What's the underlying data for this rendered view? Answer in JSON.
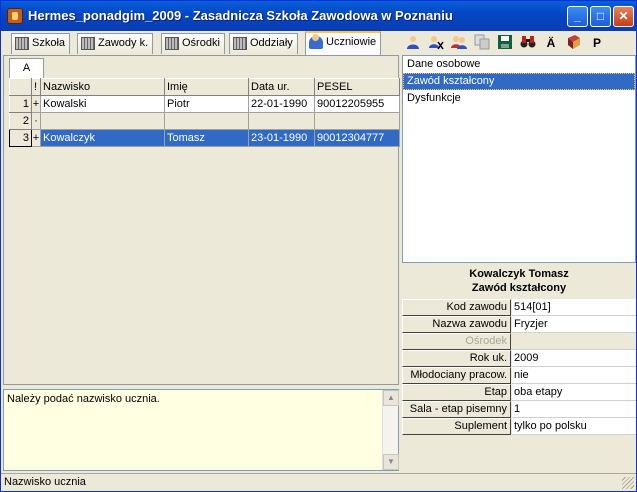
{
  "window": {
    "title": "Hermes_ponadgim_2009 - Zasadnicza Szkoła Zawodowa w Poznaniu",
    "controls": {
      "minimize": "_",
      "maximize": "□",
      "close": "✕"
    }
  },
  "tabs": [
    {
      "label": "Szkoła",
      "icon": "building-icon",
      "active": false
    },
    {
      "label": "Zawody k.",
      "icon": "building-icon",
      "active": false
    },
    {
      "label": "Ośrodki",
      "icon": "building-icon",
      "active": false
    },
    {
      "label": "Oddziały",
      "icon": "building-icon",
      "active": false
    },
    {
      "label": "Uczniowie",
      "icon": "students-icon",
      "active": true
    }
  ],
  "toolbar": {
    "icons": [
      "add-user-icon",
      "cut-user-icon",
      "move-users-icon",
      "copy-icon",
      "save-icon",
      "binoculars-icon",
      "a-umlaut-icon",
      "book-icon",
      "p-icon"
    ],
    "glyphs": {
      "a_umlaut": "Ä",
      "p": "P"
    }
  },
  "grid": {
    "filter_tab": "A",
    "columns": [
      "!",
      "Nazwisko",
      "Imię",
      "Data ur.",
      "PESEL"
    ],
    "rows": [
      {
        "num": "1",
        "flag": "+",
        "nazwisko": "Kowalski",
        "imie": "Piotr",
        "data_ur": "22-01-1990",
        "pesel": "90012205955",
        "selected": false
      },
      {
        "num": "2",
        "flag": "·",
        "nazwisko": "",
        "imie": "",
        "data_ur": "",
        "pesel": "",
        "selected": false
      },
      {
        "num": "3",
        "flag": "+",
        "nazwisko": "Kowalczyk",
        "imie": "Tomasz",
        "data_ur": "23-01-1990",
        "pesel": "90012304777",
        "selected": true
      }
    ]
  },
  "message": "Należy podać nazwisko ucznia.",
  "status": "Nazwisko ucznia",
  "sections": [
    {
      "label": "Dane osobowe",
      "selected": false
    },
    {
      "label": "Zawód kształcony",
      "selected": true
    },
    {
      "label": "Dysfunkcje",
      "selected": false
    }
  ],
  "detail": {
    "name": "Kowalczyk Tomasz",
    "section": "Zawód kształcony"
  },
  "props": [
    {
      "label": "Kod zawodu",
      "value": "514[01]",
      "disabled": false
    },
    {
      "label": "Nazwa zawodu",
      "value": "Fryzjer",
      "disabled": false
    },
    {
      "label": "Ośrodek",
      "value": "",
      "disabled": true
    },
    {
      "label": "Rok uk.",
      "value": "2009",
      "disabled": false
    },
    {
      "label": "Młodociany pracow.",
      "value": "nie",
      "disabled": false
    },
    {
      "label": "Etap",
      "value": "oba etapy",
      "disabled": false
    },
    {
      "label": "Sala - etap pisemny",
      "value": "1",
      "disabled": false
    },
    {
      "label": "Suplement",
      "value": "tylko po polsku",
      "disabled": false
    }
  ]
}
